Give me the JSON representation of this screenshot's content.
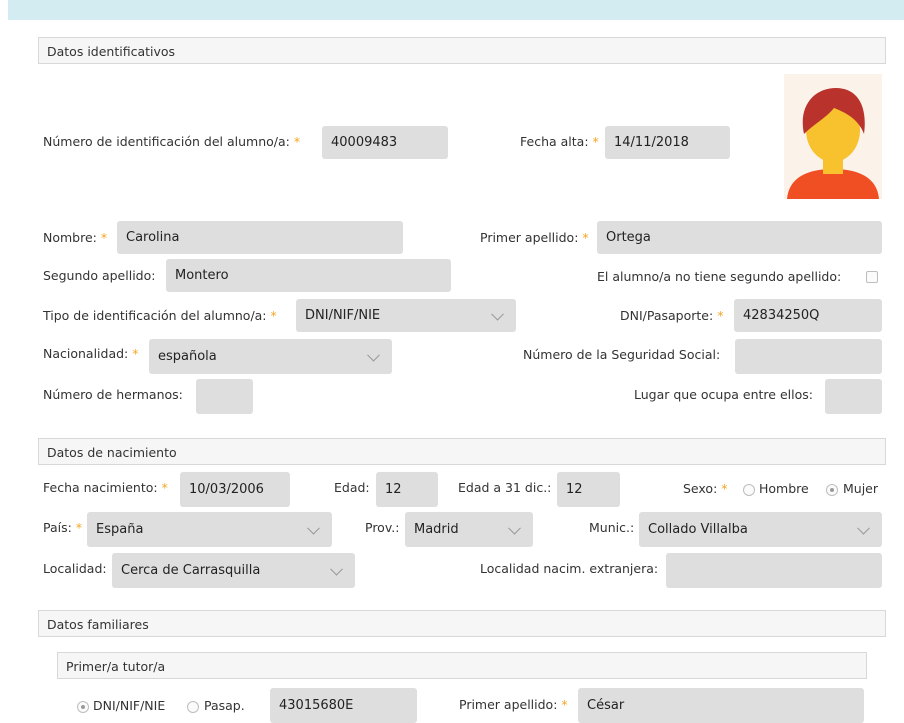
{
  "sections": {
    "identificativos": "Datos identificativos",
    "nacimiento": "Datos de nacimiento",
    "familiares": "Datos familiares",
    "tutor1": "Primer/a tutor/a"
  },
  "fields": {
    "num_id": {
      "label": "Número de identificación del alumno/a:",
      "required": "*",
      "value": "40009483"
    },
    "fecha_alta": {
      "label": "Fecha alta:",
      "required": "*",
      "value": "14/11/2018"
    },
    "nombre": {
      "label": "Nombre:",
      "required": "*",
      "value": "Carolina"
    },
    "primer_apellido": {
      "label": "Primer apellido:",
      "required": "*",
      "value": "Ortega"
    },
    "segundo_apellido": {
      "label": "Segundo apellido:",
      "value": "Montero"
    },
    "sin_segundo_apellido": {
      "label": "El alumno/a no tiene segundo apellido:"
    },
    "tipo_id": {
      "label": "Tipo de identificación del alumno/a:",
      "required": "*",
      "value": "DNI/NIF/NIE"
    },
    "dni": {
      "label": "DNI/Pasaporte:",
      "required": "*",
      "value": "42834250Q"
    },
    "nacionalidad": {
      "label": "Nacionalidad:",
      "required": "*",
      "value": "española"
    },
    "seg_social": {
      "label": "Número de la Seguridad Social:",
      "value": ""
    },
    "hermanos": {
      "label": "Número de hermanos:",
      "value": ""
    },
    "lugar": {
      "label": "Lugar que ocupa entre ellos:",
      "value": ""
    },
    "fecha_nac": {
      "label": "Fecha nacimiento:",
      "required": "*",
      "value": "10/03/2006"
    },
    "edad": {
      "label": "Edad:",
      "value": "12"
    },
    "edad_dic": {
      "label": "Edad a 31 dic.:",
      "value": "12"
    },
    "sexo": {
      "label": "Sexo:",
      "required": "*",
      "options": [
        "Hombre",
        "Mujer"
      ],
      "selected": "Mujer"
    },
    "pais": {
      "label": "País:",
      "required": "*",
      "value": "España"
    },
    "prov": {
      "label": "Prov.:",
      "value": "Madrid"
    },
    "munic": {
      "label": "Munic.:",
      "value": "Collado Villalba"
    },
    "localidad": {
      "label": "Localidad:",
      "value": "Cerca de Carrasquilla"
    },
    "localidad_ext": {
      "label": "Localidad nacim. extranjera:",
      "value": ""
    }
  },
  "tutor": {
    "doc_types": [
      "DNI/NIF/NIE",
      "Pasap."
    ],
    "doc_selected": "DNI/NIF/NIE",
    "doc_value": "43015680E",
    "primer_apellido": {
      "label": "Primer apellido:",
      "required": "*",
      "value": "César"
    }
  },
  "colors": {
    "required": "#f5a623",
    "input_bg": "#dedede",
    "section_bg": "#f6f6f6",
    "topbar": "#d2ecf2"
  },
  "icons": {
    "avatar": "student-avatar-icon",
    "dropdown": "chevron-down-icon"
  }
}
